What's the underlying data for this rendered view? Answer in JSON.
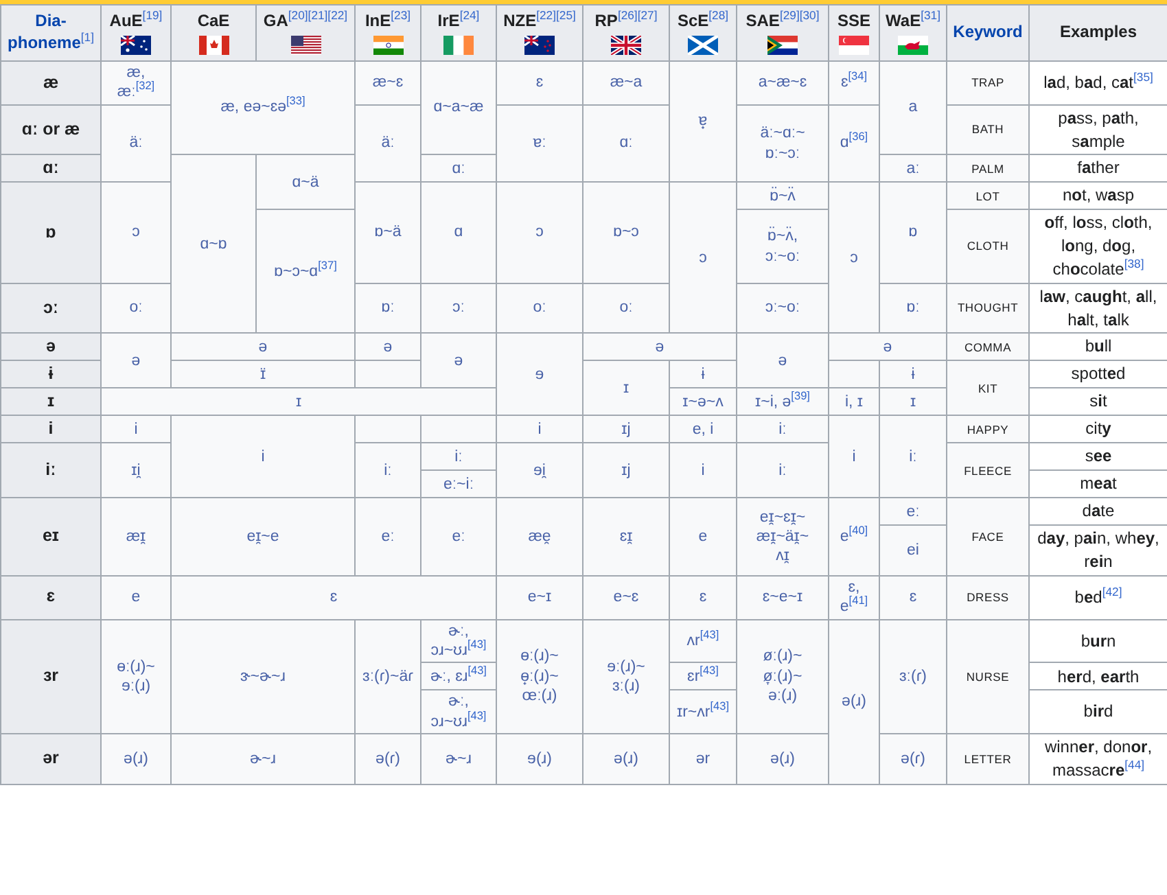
{
  "table": {
    "columns": [
      "Dia-\nphoneme$^{[1]}$",
      "AuE$^{[19]}$",
      "CaE",
      "GA$^{[20][21][22]}$",
      "InE$^{[23]}$",
      "IrE$^{[24]}$",
      "NZE$^{[22][25]}$",
      "RP$^{[26][27]}$",
      "ScE$^{[28]}$",
      "SAE$^{[29][30]}$",
      "SSE",
      "WaE$^{[31]}$",
      "Keyword",
      "Examples"
    ],
    "rows": [
      {
        "cells": [
          {
            "kind": "head",
            "text": "æ"
          },
          {
            "kind": "ipa",
            "text": "æ,\næː$^{[32]}$"
          },
          {
            "kind": "ipa",
            "text": "æ, eə~ɛə$^{[33]}$",
            "rowspan": 2,
            "colspan": 2
          },
          {
            "kind": "ipa",
            "text": "æ~ɛ"
          },
          {
            "kind": "ipa",
            "text": "ɑ~a~æ",
            "rowspan": 2
          },
          {
            "kind": "ipa",
            "text": "ɛ"
          },
          {
            "kind": "ipa",
            "text": "æ~a"
          },
          {
            "kind": "ipa",
            "text": "ɐ̟",
            "rowspan": 3
          },
          {
            "kind": "ipa",
            "text": "a~æ~ɛ"
          },
          {
            "kind": "ipa",
            "text": "ɛ$^{[34]}$"
          },
          {
            "kind": "ipa",
            "text": "a",
            "rowspan": 2
          },
          {
            "kind": "keyword",
            "text": "TRAP"
          },
          {
            "kind": "example",
            "text": "l**a**d, b**a**d, c**a**t$^{[35]}$"
          }
        ]
      },
      {
        "cells": [
          {
            "kind": "head",
            "text": "ɑː or æ"
          },
          {
            "kind": "ipa",
            "text": "äː",
            "rowspan": 2
          },
          {
            "kind": "ipa",
            "text": "äː",
            "rowspan": 2
          },
          {
            "kind": "ipa",
            "text": "ɐː",
            "rowspan": 2
          },
          {
            "kind": "ipa",
            "text": "ɑː",
            "rowspan": 2
          },
          {
            "kind": "ipa",
            "text": "äː~ɑː~\nɒː~ɔː",
            "rowspan": 2
          },
          {
            "kind": "ipa",
            "text": "ɑ$^{[36]}$",
            "rowspan": 2
          },
          {
            "kind": "keyword",
            "text": "BATH"
          },
          {
            "kind": "example",
            "text": "p**a**ss, p**a**th, s**a**mple"
          }
        ]
      },
      {
        "cells": [
          {
            "kind": "head",
            "text": "ɑː"
          },
          {
            "kind": "ipa",
            "text": "ɑ~ɒ",
            "rowspan": 4
          },
          {
            "kind": "ipa",
            "text": "ɑ~ä",
            "rowspan": 2
          },
          {
            "kind": "ipa",
            "text": "ɑː"
          },
          {
            "kind": "ipa",
            "text": "aː"
          },
          {
            "kind": "keyword",
            "text": "PALM"
          },
          {
            "kind": "example",
            "text": "f**a**ther"
          }
        ]
      },
      {
        "cells": [
          {
            "kind": "head",
            "text": "ɒ",
            "rowspan": 2
          },
          {
            "kind": "ipa",
            "text": "ɔ",
            "rowspan": 2
          },
          {
            "kind": "ipa",
            "text": "ɒ~ä",
            "rowspan": 2
          },
          {
            "kind": "ipa",
            "text": "ɑ",
            "rowspan": 2
          },
          {
            "kind": "ipa",
            "text": "ɔ",
            "rowspan": 2
          },
          {
            "kind": "ipa",
            "text": "ɒ~ɔ",
            "rowspan": 2
          },
          {
            "kind": "ipa",
            "text": "ɔ",
            "rowspan": 3
          },
          {
            "kind": "ipa",
            "text": "ɒ̈~ʌ̈"
          },
          {
            "kind": "ipa",
            "text": "ɔ",
            "rowspan": 3
          },
          {
            "kind": "ipa",
            "text": "ɒ",
            "rowspan": 2
          },
          {
            "kind": "keyword",
            "text": "LOT"
          },
          {
            "kind": "example",
            "text": "n**o**t, w**a**sp"
          }
        ]
      },
      {
        "cells": [
          {
            "kind": "ipa",
            "text": "ɒ~ɔ~ɑ$^{[37]}$",
            "rowspan": 2
          },
          {
            "kind": "ipa",
            "text": "ɒ̈~ʌ̈,\nɔː~oː"
          },
          {
            "kind": "keyword",
            "text": "CLOTH"
          },
          {
            "kind": "example",
            "text": "**o**ff, l**o**ss, cl**o**th, l**o**ng, d**o**g, ch**o**colate$^{[38]}$"
          }
        ]
      },
      {
        "cells": [
          {
            "kind": "head",
            "text": "ɔː"
          },
          {
            "kind": "ipa",
            "text": "oː"
          },
          {
            "kind": "ipa",
            "text": "ɒː"
          },
          {
            "kind": "ipa",
            "text": "ɔː"
          },
          {
            "kind": "ipa",
            "text": "oː"
          },
          {
            "kind": "ipa",
            "text": "oː"
          },
          {
            "kind": "ipa",
            "text": "ɔː~oː"
          },
          {
            "kind": "ipa",
            "text": "ɒː"
          },
          {
            "kind": "keyword",
            "text": "THOUGHT"
          },
          {
            "kind": "example",
            "text": "l**aw**, c**augh**t, **a**ll, h**a**lt, t**a**lk"
          }
        ]
      },
      {
        "cells": [
          {
            "kind": "head",
            "text": "ə"
          },
          {
            "kind": "ipa",
            "text": "ə",
            "rowspan": 2
          },
          {
            "kind": "ipa",
            "text": "ə",
            "colspan": 2
          },
          {
            "kind": "ipa",
            "text": "ə"
          },
          {
            "kind": "ipa",
            "text": "ə",
            "rowspan": 2
          },
          {
            "kind": "ipa",
            "text": "ɘ",
            "rowspan": 3
          },
          {
            "kind": "ipa",
            "text": "ə",
            "colspan": 2
          },
          {
            "kind": "ipa",
            "text": "ə",
            "rowspan": 2
          },
          {
            "kind": "ipa",
            "text": "ə",
            "colspan": 2
          },
          {
            "kind": "keyword",
            "text": "COMMA"
          },
          {
            "kind": "example",
            "text": "b**u**ll"
          }
        ]
      },
      {
        "cells": [
          {
            "kind": "head",
            "text": "ɨ"
          },
          {
            "kind": "ipa",
            "text": "ɪ̈",
            "colspan": 2
          },
          {
            "kind": "ipa"
          },
          {
            "kind": "ipa",
            "text": "ɪ",
            "rowspan": 2
          },
          {
            "kind": "ipa",
            "text": "ɨ"
          },
          {
            "kind": "ipa"
          },
          {
            "kind": "ipa",
            "text": "ɨ"
          },
          {
            "kind": "keyword",
            "text": "KIT",
            "rowspan": 2
          },
          {
            "kind": "example",
            "text": "spott**e**d"
          }
        ]
      },
      {
        "cells": [
          {
            "kind": "head",
            "text": "ɪ"
          },
          {
            "kind": "ipa",
            "text": "ɪ",
            "colspan": 5
          },
          {
            "kind": "ipa",
            "text": "ɪ~ə~ʌ"
          },
          {
            "kind": "ipa",
            "text": "ɪ~i, ə$^{[39]}$"
          },
          {
            "kind": "ipa",
            "text": "i, ɪ"
          },
          {
            "kind": "ipa",
            "text": "ɪ"
          },
          {
            "kind": "example",
            "text": "s**i**t"
          }
        ]
      },
      {
        "cells": [
          {
            "kind": "head",
            "text": "i"
          },
          {
            "kind": "ipa",
            "text": "i"
          },
          {
            "kind": "ipa",
            "text": "i",
            "rowspan": 3,
            "colspan": 2
          },
          {
            "kind": "ipa"
          },
          {
            "kind": "ipa"
          },
          {
            "kind": "ipa",
            "text": "i"
          },
          {
            "kind": "ipa",
            "text": "ɪj"
          },
          {
            "kind": "ipa",
            "text": "e, i"
          },
          {
            "kind": "ipa",
            "text": "iː"
          },
          {
            "kind": "ipa",
            "text": "i",
            "rowspan": 3
          },
          {
            "kind": "ipa",
            "text": "iː",
            "rowspan": 3
          },
          {
            "kind": "keyword",
            "text": "HAPPY"
          },
          {
            "kind": "example",
            "text": "cit**y**"
          }
        ]
      },
      {
        "cells": [
          {
            "kind": "head",
            "text": "iː",
            "rowspan": 2
          },
          {
            "kind": "ipa",
            "text": "ɪi̯",
            "rowspan": 2
          },
          {
            "kind": "ipa",
            "text": "iː",
            "rowspan": 2
          },
          {
            "kind": "ipa",
            "text": "iː"
          },
          {
            "kind": "ipa",
            "text": "ɘi̯",
            "rowspan": 2
          },
          {
            "kind": "ipa",
            "text": "ɪj",
            "rowspan": 2
          },
          {
            "kind": "ipa",
            "text": "i",
            "rowspan": 2
          },
          {
            "kind": "ipa",
            "text": "iː",
            "rowspan": 2
          },
          {
            "kind": "keyword",
            "text": "FLEECE",
            "rowspan": 2
          },
          {
            "kind": "example",
            "text": "s**ee**"
          }
        ]
      },
      {
        "cells": [
          {
            "kind": "ipa",
            "text": "eː~iː"
          },
          {
            "kind": "example",
            "text": "m**ea**t"
          }
        ]
      },
      {
        "cells": [
          {
            "kind": "head",
            "text": "eɪ",
            "rowspan": 2
          },
          {
            "kind": "ipa",
            "text": "æɪ̯",
            "rowspan": 2
          },
          {
            "kind": "ipa",
            "text": "eɪ̯~e",
            "rowspan": 2,
            "colspan": 2
          },
          {
            "kind": "ipa",
            "text": "eː",
            "rowspan": 2
          },
          {
            "kind": "ipa",
            "text": "eː",
            "rowspan": 2
          },
          {
            "kind": "ipa",
            "text": "æe̯",
            "rowspan": 2
          },
          {
            "kind": "ipa",
            "text": "ɛɪ̯",
            "rowspan": 2
          },
          {
            "kind": "ipa",
            "text": "e",
            "rowspan": 2
          },
          {
            "kind": "ipa",
            "text": "eɪ̯~ɛɪ̯~\næɪ̯~äɪ̯~\nʌɪ̯",
            "rowspan": 2
          },
          {
            "kind": "ipa",
            "text": "e$^{[40]}$",
            "rowspan": 2
          },
          {
            "kind": "ipa",
            "text": "eː"
          },
          {
            "kind": "keyword",
            "text": "FACE",
            "rowspan": 2
          },
          {
            "kind": "example",
            "text": "d**a**te"
          }
        ]
      },
      {
        "cells": [
          {
            "kind": "ipa",
            "text": "ei"
          },
          {
            "kind": "example",
            "text": "d**ay**, p**ai**n, wh**ey**, r**ei**n"
          }
        ]
      },
      {
        "cells": [
          {
            "kind": "head",
            "text": "ɛ"
          },
          {
            "kind": "ipa",
            "text": "e"
          },
          {
            "kind": "ipa",
            "text": "ɛ",
            "colspan": 4
          },
          {
            "kind": "ipa",
            "text": "e~ɪ"
          },
          {
            "kind": "ipa",
            "text": "e~ɛ"
          },
          {
            "kind": "ipa",
            "text": "ɛ"
          },
          {
            "kind": "ipa",
            "text": "ɛ~e~ɪ"
          },
          {
            "kind": "ipa",
            "text": "ɛ,\ne$^{[41]}$"
          },
          {
            "kind": "ipa",
            "text": "ɛ"
          },
          {
            "kind": "keyword",
            "text": "DRESS"
          },
          {
            "kind": "example",
            "text": "b**e**d$^{[42]}$"
          }
        ]
      },
      {
        "cells": [
          {
            "kind": "head",
            "text": "ɜr",
            "rowspan": 3
          },
          {
            "kind": "ipa",
            "text": "ɵː(ɹ)~\nɘː(ɹ)",
            "rowspan": 3
          },
          {
            "kind": "ipa",
            "text": "ɝ~ɚ~ɹ",
            "rowspan": 3,
            "colspan": 2
          },
          {
            "kind": "ipa",
            "text": "ɜː(ɾ)~äɾ",
            "rowspan": 3
          },
          {
            "kind": "ipa",
            "text": "ɚː,\nɔɹ~ʊɹ$^{[43]}$"
          },
          {
            "kind": "ipa",
            "text": "ɵː(ɹ)~\nɵ̟ː(ɹ)~\nœː(ɹ)",
            "rowspan": 3
          },
          {
            "kind": "ipa",
            "text": "ɘː(ɹ)~\nɜː(ɹ)",
            "rowspan": 3
          },
          {
            "kind": "ipa",
            "text": "ʌr$^{[43]}$"
          },
          {
            "kind": "ipa",
            "text": "øː(ɹ)~\nø̞ː(ɹ)~\nəː(ɹ)",
            "rowspan": 3
          },
          {
            "kind": "ipa",
            "text": "ə(ɹ)",
            "rowspan": 4
          },
          {
            "kind": "ipa",
            "text": "ɜː(ɾ)",
            "rowspan": 3
          },
          {
            "kind": "keyword",
            "text": "NURSE",
            "rowspan": 3
          },
          {
            "kind": "example",
            "text": "b**ur**n"
          }
        ]
      },
      {
        "cells": [
          {
            "kind": "ipa",
            "text": "ɚː, ɛɹ$^{[43]}$"
          },
          {
            "kind": "ipa",
            "text": "ɛr$^{[43]}$"
          },
          {
            "kind": "example",
            "text": "h**er**d, **ear**th"
          }
        ]
      },
      {
        "cells": [
          {
            "kind": "ipa",
            "text": "ɚː,\nɔɹ~ʊɹ$^{[43]}$"
          },
          {
            "kind": "ipa",
            "text": "ɪr~ʌr$^{[43]}$"
          },
          {
            "kind": "example",
            "text": "b**ir**d"
          }
        ]
      },
      {
        "cells": [
          {
            "kind": "head",
            "text": "ər"
          },
          {
            "kind": "ipa",
            "text": "ə(ɹ)"
          },
          {
            "kind": "ipa",
            "text": "ɚ~ɹ",
            "colspan": 2
          },
          {
            "kind": "ipa",
            "text": "ə(ɾ)"
          },
          {
            "kind": "ipa",
            "text": "ɚ~ɹ"
          },
          {
            "kind": "ipa",
            "text": "ɘ(ɹ)"
          },
          {
            "kind": "ipa",
            "text": "ə(ɹ)"
          },
          {
            "kind": "ipa",
            "text": "ər"
          },
          {
            "kind": "ipa",
            "text": "ə(ɹ)"
          },
          {
            "kind": "ipa",
            "text": "ə(ɾ)"
          },
          {
            "kind": "keyword",
            "text": "LETTER"
          },
          {
            "kind": "example",
            "text": "winn**er**, don**or**, massac**re**$^{[44]}$"
          }
        ]
      }
    ]
  }
}
